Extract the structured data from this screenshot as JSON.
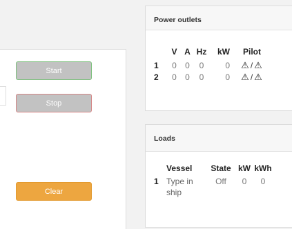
{
  "controls": {
    "start_label": "Start",
    "stop_label": "Stop",
    "clear_label": "Clear"
  },
  "power_outlets": {
    "title": "Power outlets",
    "columns": [
      "",
      "V",
      "A",
      "Hz",
      "kW",
      "Pilot"
    ],
    "rows": [
      {
        "id": "1",
        "v": "0",
        "a": "0",
        "hz": "0",
        "kw": "0",
        "pilot_left_icon": "warning-triangle",
        "pilot_sep": "/",
        "pilot_right_icon": "warning-triangle"
      },
      {
        "id": "2",
        "v": "0",
        "a": "0",
        "hz": "0",
        "kw": "0",
        "pilot_left_icon": "warning-triangle",
        "pilot_sep": "/",
        "pilot_right_icon": "warning-triangle"
      }
    ]
  },
  "loads": {
    "title": "Loads",
    "columns": [
      "",
      "Vessel",
      "State",
      "kW",
      "kWh"
    ],
    "rows": [
      {
        "id": "1",
        "vessel": "Type in ship",
        "state": "Off",
        "kw": "0",
        "kwh": "0"
      }
    ]
  },
  "colors": {
    "start_border": "#7bbf7b",
    "stop_border": "#d48585",
    "clear_bg": "#eda640",
    "disabled_bg": "#c2c2c2"
  }
}
